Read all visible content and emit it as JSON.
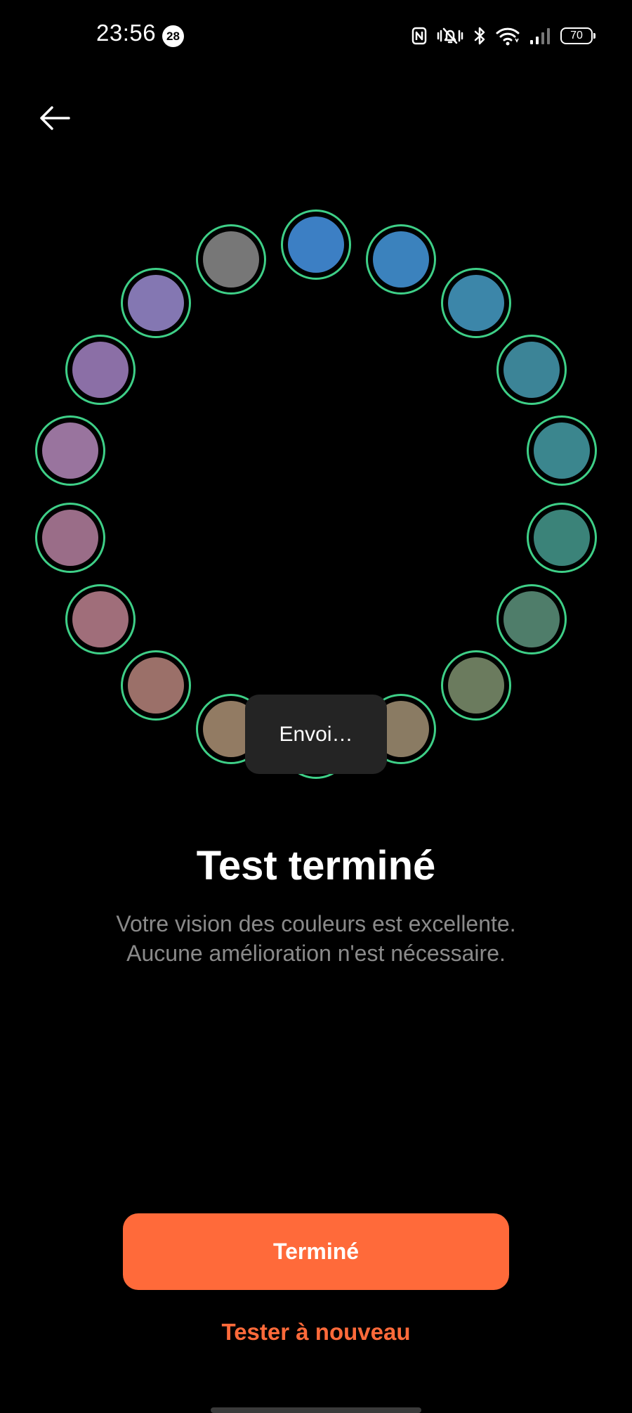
{
  "status_bar": {
    "time": "23:56",
    "notification_count": "28",
    "battery_level": "70",
    "icons": [
      "nfc-icon",
      "vibrate-silent-icon",
      "bluetooth-icon",
      "wifi-icon",
      "signal-icon",
      "battery-icon"
    ]
  },
  "header": {
    "back_icon": "arrow-left-icon"
  },
  "color_ring": {
    "cap_count": 18,
    "selection_border_color": "#3ecf87",
    "caps": [
      {
        "color": "#3c7fc4"
      },
      {
        "color": "#3b82bd"
      },
      {
        "color": "#3c86a9"
      },
      {
        "color": "#3c8497"
      },
      {
        "color": "#3b868e"
      },
      {
        "color": "#3b8379"
      },
      {
        "color": "#4f7d6a"
      },
      {
        "color": "#6b7b5e"
      },
      {
        "color": "#8a7b63"
      },
      {
        "color": "#927b63"
      },
      {
        "color": "#9b7069"
      },
      {
        "color": "#a06e7a"
      },
      {
        "color": "#9a6d88"
      },
      {
        "color": "#99749e"
      },
      {
        "color": "#8b6fa6"
      },
      {
        "color": "#8477b2"
      }
    ]
  },
  "toast": {
    "text": "Envoi…"
  },
  "result": {
    "title": "Test terminé",
    "line1": "Votre vision des couleurs est excellente.",
    "line2": "Aucune amélioration n'est nécessaire."
  },
  "actions": {
    "done_label": "Terminé",
    "retry_label": "Tester à nouveau",
    "accent_color": "#ff6a3a"
  }
}
